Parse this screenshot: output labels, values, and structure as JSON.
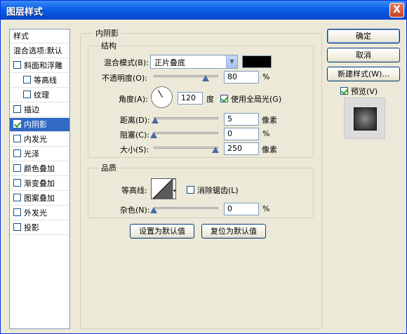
{
  "window": {
    "title": "图层样式",
    "close": "X"
  },
  "styles_list": {
    "header": "样式",
    "blend_options": "混合选项:默认",
    "items": [
      {
        "label": "斜面和浮雕",
        "checked": false,
        "indent": false
      },
      {
        "label": "等高线",
        "checked": false,
        "indent": true
      },
      {
        "label": "纹理",
        "checked": false,
        "indent": true
      },
      {
        "label": "描边",
        "checked": false,
        "indent": false
      },
      {
        "label": "内阴影",
        "checked": true,
        "indent": false,
        "selected": true
      },
      {
        "label": "内发光",
        "checked": false,
        "indent": false
      },
      {
        "label": "光泽",
        "checked": false,
        "indent": false
      },
      {
        "label": "颜色叠加",
        "checked": false,
        "indent": false
      },
      {
        "label": "渐变叠加",
        "checked": false,
        "indent": false
      },
      {
        "label": "图案叠加",
        "checked": false,
        "indent": false
      },
      {
        "label": "外发光",
        "checked": false,
        "indent": false
      },
      {
        "label": "投影",
        "checked": false,
        "indent": false
      }
    ]
  },
  "inner_shadow": {
    "title": "内阴影",
    "structure": {
      "title": "结构",
      "blend_mode_label": "混合模式(B):",
      "blend_mode_value": "正片叠底",
      "color": "#000000",
      "opacity_label": "不透明度(O):",
      "opacity_value": "80",
      "opacity_unit": "%",
      "opacity_level": 0.8,
      "angle_label": "角度(A):",
      "angle_value": "120",
      "angle_unit": "度",
      "global_light_label": "使用全局光(G)",
      "global_light_checked": true,
      "distance_label": "距离(D):",
      "distance_value": "5",
      "distance_unit": "像素",
      "choke_label": "阻塞(C):",
      "choke_value": "0",
      "choke_unit": "%",
      "size_label": "大小(S):",
      "size_value": "250",
      "size_unit": "像素"
    },
    "quality": {
      "title": "品质",
      "contour_label": "等高线:",
      "antialias_label": "消除锯齿(L)",
      "antialias_checked": false,
      "noise_label": "杂色(N):",
      "noise_value": "0",
      "noise_unit": "%"
    },
    "set_default_button": "设置为默认值",
    "reset_default_button": "复位为默认值"
  },
  "buttons": {
    "ok": "确定",
    "cancel": "取消",
    "new_style": "新建样式(W)...",
    "preview_label": "预览(V)",
    "preview_checked": true
  }
}
